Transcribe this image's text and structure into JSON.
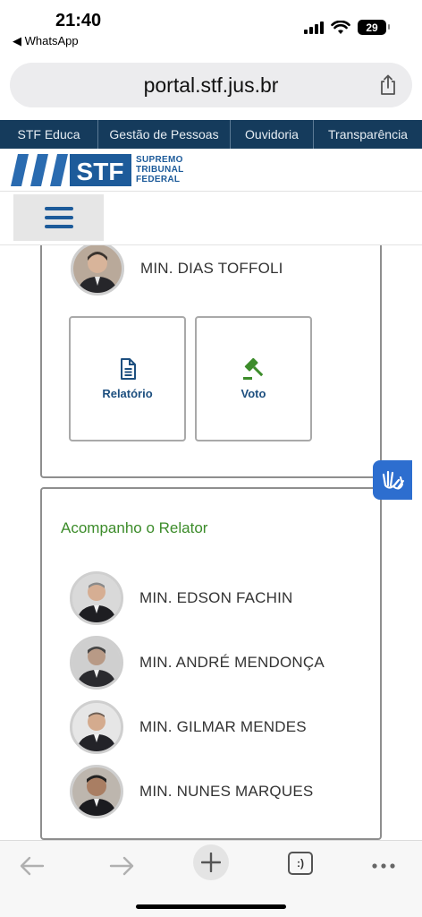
{
  "status": {
    "time": "21:40",
    "back_app": "◀ WhatsApp",
    "battery": "29"
  },
  "browser": {
    "url": "portal.stf.jus.br"
  },
  "top_nav": {
    "items": [
      "STF Educa",
      "Gestão de Pessoas",
      "Ouvidoria",
      "Transparência"
    ]
  },
  "header": {
    "logo_text": "STF",
    "logo_line1": "SUPREMO",
    "logo_line2": "TRIBUNAL",
    "logo_line3": "FEDERAL"
  },
  "relator_panel": {
    "minister": "MIN. DIAS TOFFOLI",
    "actions": [
      {
        "label": "Relatório",
        "icon": "document-icon"
      },
      {
        "label": "Voto",
        "icon": "gavel-icon"
      }
    ]
  },
  "vote_panel": {
    "heading": "Acompanho o Relator",
    "ministers": [
      "MIN. EDSON FACHIN",
      "MIN. ANDRÉ MENDONÇA",
      "MIN. GILMAR MENDES",
      "MIN. NUNES MARQUES"
    ]
  },
  "colors": {
    "nav_bg": "#153b5c",
    "brand_blue": "#1d5b9a",
    "accent_green": "#3c8c2a",
    "accessibility_blue": "#2d6ecf"
  },
  "toolbar": {
    "tabs_label": ":)"
  }
}
